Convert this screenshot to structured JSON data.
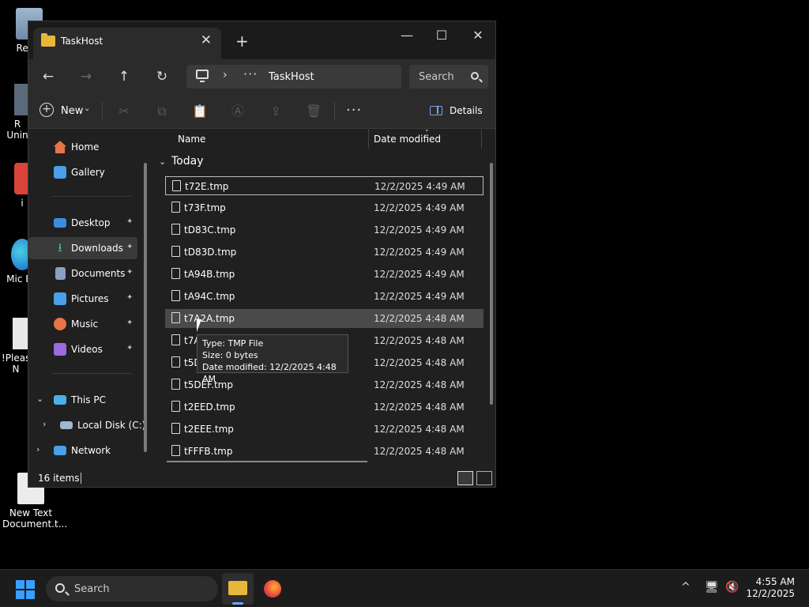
{
  "desktop": {
    "icons": [
      {
        "label": "Recy"
      },
      {
        "label": "R Unin"
      },
      {
        "label": "i"
      },
      {
        "label": "Mic E"
      },
      {
        "label": "!Pleas N"
      },
      {
        "label": "New Text Document.t..."
      }
    ]
  },
  "window": {
    "tab_title": "TaskHost",
    "tab_close": "✕",
    "new_tab": "+",
    "minimize": "—",
    "maximize": "☐",
    "close": "✕"
  },
  "nav": {
    "back": "←",
    "forward": "→",
    "up": "↑",
    "refresh": "↻",
    "breadcrumb_sep": "›",
    "breadcrumb_more": "···",
    "breadcrumb": "TaskHost",
    "search_placeholder": "Search"
  },
  "commandbar": {
    "new_label": "New",
    "new_caret": "⌄",
    "more": "···",
    "details_label": "Details"
  },
  "sidebar": {
    "items": [
      {
        "label": "Home",
        "color": "#e8744a"
      },
      {
        "label": "Gallery",
        "color": "#4aa0e8"
      },
      {
        "label": "Desktop",
        "color": "#3a8ee0"
      },
      {
        "label": "Downloads",
        "color": "#4ac080"
      },
      {
        "label": "Documents",
        "color": "#8aa0c0"
      },
      {
        "label": "Pictures",
        "color": "#4aa0e8"
      },
      {
        "label": "Music",
        "color": "#e8744a"
      },
      {
        "label": "Videos",
        "color": "#9a6ae0"
      },
      {
        "label": "This PC",
        "color": "#4ab0e8"
      },
      {
        "label": "Local Disk (C:)",
        "color": "#a0b8d0"
      },
      {
        "label": "Network",
        "color": "#4aa0e8"
      }
    ],
    "pin": "📌"
  },
  "content": {
    "col_name": "Name",
    "col_date": "Date modified",
    "group": "Today",
    "rows": [
      {
        "name": "t72E.tmp",
        "date": "12/2/2025 4:49 AM"
      },
      {
        "name": "t73F.tmp",
        "date": "12/2/2025 4:49 AM"
      },
      {
        "name": "tD83C.tmp",
        "date": "12/2/2025 4:49 AM"
      },
      {
        "name": "tD83D.tmp",
        "date": "12/2/2025 4:49 AM"
      },
      {
        "name": "tA94B.tmp",
        "date": "12/2/2025 4:49 AM"
      },
      {
        "name": "tA94C.tmp",
        "date": "12/2/2025 4:49 AM"
      },
      {
        "name": "t7A2A.tmp",
        "date": "12/2/2025 4:48 AM"
      },
      {
        "name": "t7A",
        "date": "12/2/2025 4:48 AM"
      },
      {
        "name": "t5D",
        "date": "12/2/2025 4:48 AM"
      },
      {
        "name": "t5DEF.tmp",
        "date": "12/2/2025 4:48 AM"
      },
      {
        "name": "t2EED.tmp",
        "date": "12/2/2025 4:48 AM"
      },
      {
        "name": "t2EEE.tmp",
        "date": "12/2/2025 4:48 AM"
      },
      {
        "name": "tFFFB.tmp",
        "date": "12/2/2025 4:48 AM"
      }
    ]
  },
  "tooltip": {
    "line1": "Type: TMP File",
    "line2": "Size: 0 bytes",
    "line3": "Date modified: 12/2/2025 4:48 AM"
  },
  "status": {
    "count": "16 items"
  },
  "taskbar": {
    "search_placeholder": "Search",
    "tray_chevron": "^",
    "time": "4:55 AM",
    "date": "12/2/2025"
  }
}
